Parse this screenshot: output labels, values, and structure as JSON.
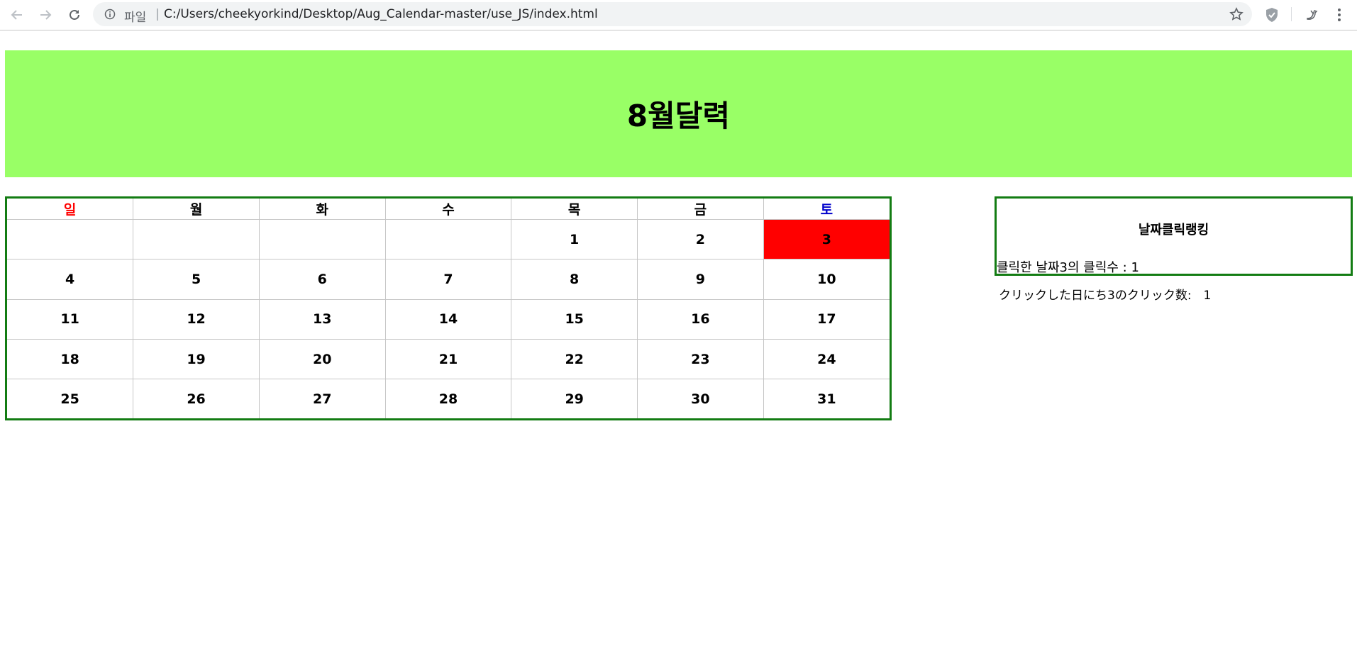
{
  "browser": {
    "scheme_label": "파일",
    "separator": "|",
    "url": "C:/Users/cheekyorkind/Desktop/Aug_Calendar-master/use_JS/index.html"
  },
  "header": {
    "title": "8월달력"
  },
  "calendar": {
    "weekdays": [
      "일",
      "월",
      "화",
      "수",
      "목",
      "금",
      "토"
    ],
    "colors": {
      "sunday": "#ff0000",
      "saturday": "#0000cc",
      "highlight": "#ff0000",
      "border": "#137c13",
      "banner": "#99ff66"
    },
    "weeks": [
      [
        "",
        "",
        "",
        "",
        "1",
        "2",
        "3"
      ],
      [
        "4",
        "5",
        "6",
        "7",
        "8",
        "9",
        "10"
      ],
      [
        "11",
        "12",
        "13",
        "14",
        "15",
        "16",
        "17"
      ],
      [
        "18",
        "19",
        "20",
        "21",
        "22",
        "23",
        "24"
      ],
      [
        "25",
        "26",
        "27",
        "28",
        "29",
        "30",
        "31"
      ]
    ],
    "highlighted_day": "3"
  },
  "ranking": {
    "title": "날짜클릭랭킹",
    "line": "클릭한 날짜3의 클릭수 : 1"
  },
  "japanese_line": "クリックした日にち3のクリック数:　1"
}
